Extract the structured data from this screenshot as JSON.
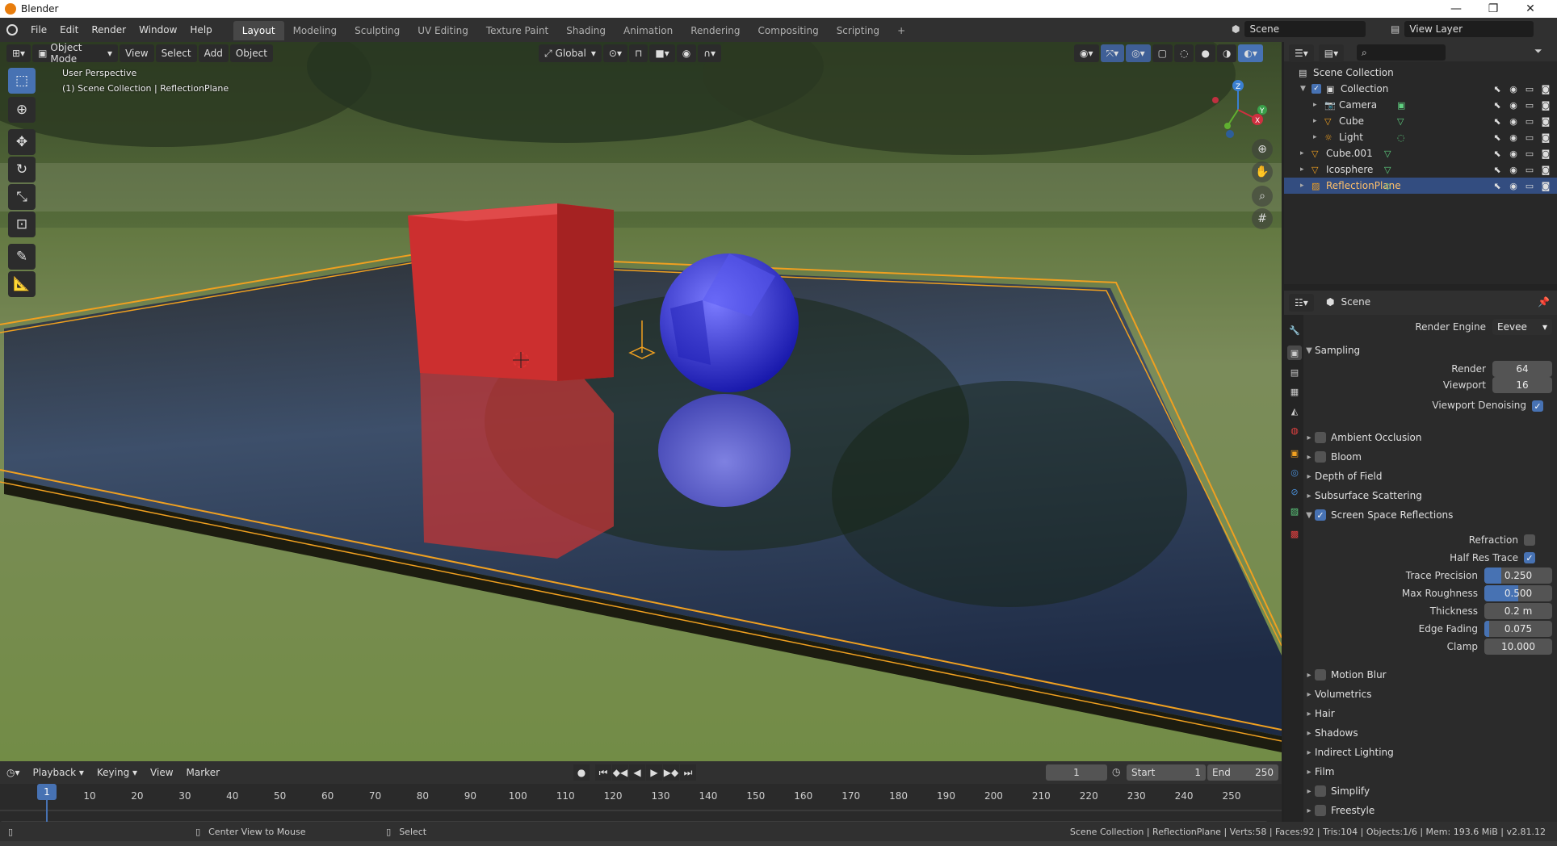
{
  "window": {
    "title": "Blender",
    "min": "—",
    "max": "❐",
    "close": "✕"
  },
  "menubar": {
    "menus": [
      "File",
      "Edit",
      "Render",
      "Window",
      "Help"
    ],
    "workspaces": [
      "Layout",
      "Modeling",
      "Sculpting",
      "UV Editing",
      "Texture Paint",
      "Shading",
      "Animation",
      "Rendering",
      "Compositing",
      "Scripting"
    ],
    "add_tab": "+",
    "scene": "Scene",
    "view_layer": "View Layer"
  },
  "viewport": {
    "mode": "Object Mode",
    "menus": [
      "View",
      "Select",
      "Add",
      "Object"
    ],
    "transform_orientation": "Global",
    "overlay_title": "User Perspective",
    "overlay_sub": "(1) Scene Collection | ReflectionPlane",
    "gizmo": {
      "x": "X",
      "y": "Y",
      "z": "Z"
    }
  },
  "outliner": {
    "search_placeholder": "",
    "rows": [
      {
        "label": "Scene Collection",
        "kind": "scene",
        "indent": 0
      },
      {
        "label": "Collection",
        "kind": "collection",
        "indent": 1
      },
      {
        "label": "Camera",
        "kind": "camera",
        "indent": 2
      },
      {
        "label": "Cube",
        "kind": "mesh",
        "indent": 2
      },
      {
        "label": "Light",
        "kind": "light",
        "indent": 2
      },
      {
        "label": "Cube.001",
        "kind": "mesh",
        "indent": 1
      },
      {
        "label": "Icosphere",
        "kind": "mesh",
        "indent": 1
      },
      {
        "label": "ReflectionPlane",
        "kind": "probe",
        "indent": 1
      }
    ]
  },
  "properties": {
    "context": "Scene",
    "render_engine_label": "Render Engine",
    "render_engine": "Eevee",
    "sampling": {
      "title": "Sampling",
      "render_label": "Render",
      "render": "64",
      "viewport_label": "Viewport",
      "viewport": "16",
      "denoise_label": "Viewport Denoising"
    },
    "panels_a": [
      "Ambient Occlusion",
      "Bloom",
      "Depth of Field",
      "Subsurface Scattering"
    ],
    "ssr": {
      "title": "Screen Space Reflections",
      "refraction": "Refraction",
      "half_res": "Half Res Trace",
      "trace_precision_label": "Trace Precision",
      "trace_precision": "0.250",
      "trace_precision_frac": 0.25,
      "max_roughness_label": "Max Roughness",
      "max_roughness": "0.500",
      "max_roughness_frac": 0.5,
      "thickness_label": "Thickness",
      "thickness": "0.2 m",
      "edge_fading_label": "Edge Fading",
      "edge_fading": "0.075",
      "edge_fading_frac": 0.075,
      "clamp_label": "Clamp",
      "clamp": "10.000"
    },
    "panels_b": [
      "Motion Blur",
      "Volumetrics",
      "Hair",
      "Shadows",
      "Indirect Lighting",
      "Film",
      "Simplify",
      "Freestyle"
    ]
  },
  "timeline": {
    "menus": [
      "Playback",
      "Keying",
      "View",
      "Marker"
    ],
    "current_frame": "1",
    "start_label": "Start",
    "start": "1",
    "end_label": "End",
    "end": "250",
    "ticks": [
      "1",
      "10",
      "20",
      "30",
      "40",
      "50",
      "60",
      "70",
      "80",
      "90",
      "100",
      "110",
      "120",
      "130",
      "140",
      "150",
      "160",
      "170",
      "180",
      "190",
      "200",
      "210",
      "220",
      "230",
      "240",
      "250"
    ]
  },
  "statusbar": {
    "hint1": "Center View to Mouse",
    "hint2": "Select",
    "stats": "Scene Collection | ReflectionPlane | Verts:58 | Faces:92 | Tris:104 | Objects:1/6 | Mem: 193.6 MiB | v2.81.12"
  }
}
